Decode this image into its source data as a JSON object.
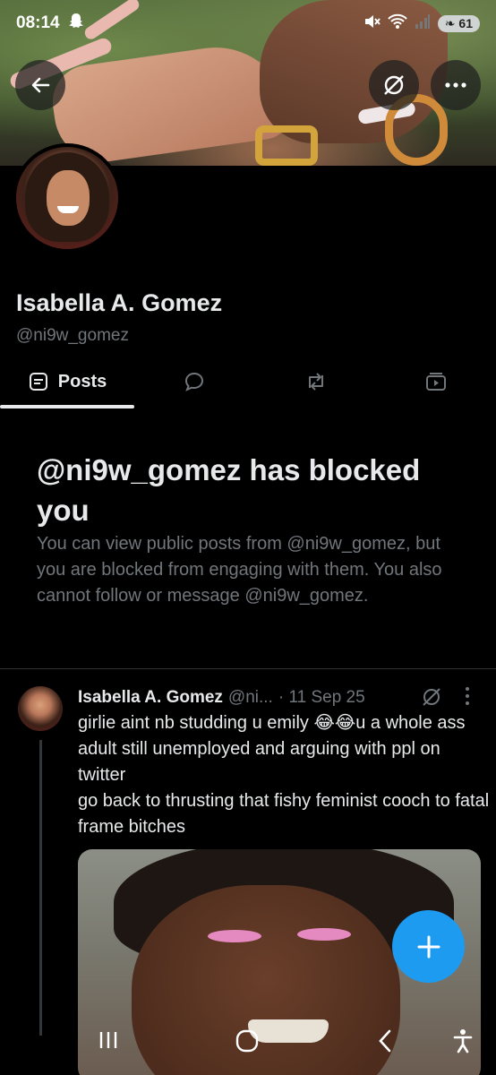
{
  "status_bar": {
    "time": "08:14",
    "battery": "61"
  },
  "profile": {
    "name": "Isabella A. Gomez",
    "handle": "@ni9w_gomez"
  },
  "tabs": {
    "posts_label": "Posts"
  },
  "blocked": {
    "title": "@ni9w_gomez has blocked you",
    "description": "You can view public posts from @ni9w_gomez, but you are blocked from engaging with them. You also cannot follow or message @ni9w_gomez."
  },
  "post": {
    "author_name": "Isabella A. Gomez",
    "author_handle": "@ni...",
    "date": "· 11 Sep 25",
    "text_line1": "girlie aint nb studding u emily 😂😂u a whole ass adult still unemployed and arguing with ppl on twitter",
    "text_line2": "go back to thrusting that fishy feminist cooch to fatal frame bitches"
  },
  "fab": {
    "icon": "plus-icon"
  },
  "colors": {
    "accent": "#1d9bf0",
    "background": "#000000",
    "muted_text": "#71767b",
    "primary_text": "#e7e9ea"
  }
}
